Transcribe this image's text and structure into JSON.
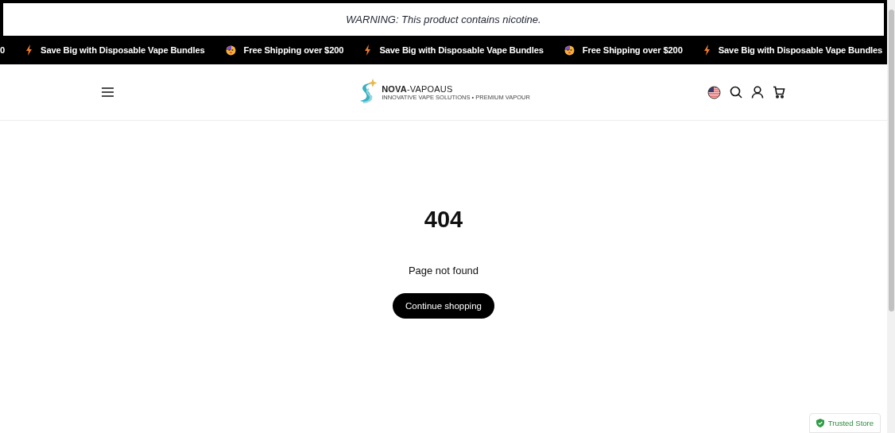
{
  "warning": {
    "text": "WARNING: This product contains nicotine."
  },
  "marquee": [
    {
      "kind": "text",
      "text": "0"
    },
    {
      "kind": "bolt",
      "text": "Save Big with Disposable Vape Bundles"
    },
    {
      "kind": "emoji",
      "text": "Free Shipping over $200"
    },
    {
      "kind": "bolt",
      "text": "Save Big with Disposable Vape Bundles"
    },
    {
      "kind": "emoji",
      "text": "Free Shipping over $200"
    },
    {
      "kind": "bolt",
      "text": "Save Big with Disposable Vape Bundles"
    }
  ],
  "logo": {
    "name": "**NOVA**-VAPOAUS",
    "tagline": "INNOVATIVE VAPE SOLUTIONS • PREMIUM VAPOUR"
  },
  "error": {
    "code": "404",
    "message": "Page not found",
    "button": "Continue shopping"
  },
  "badge": {
    "text": "Trusted Store"
  }
}
